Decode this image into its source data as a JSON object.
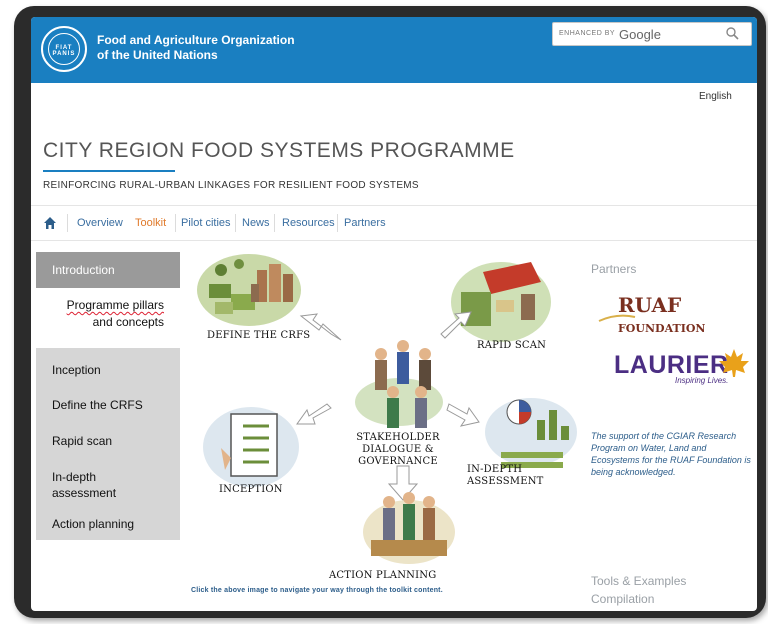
{
  "header": {
    "org_line1": "Food and Agriculture Organization",
    "org_line2": "of the United Nations",
    "logo_text": "FIAT PANIS",
    "search_enhanced": "ENHANCED BY",
    "search_brand": "Google"
  },
  "language": "English",
  "page": {
    "title": "CITY REGION FOOD SYSTEMS PROGRAMME",
    "subtitle": "REINFORCING RURAL-URBAN LINKAGES FOR RESILIENT FOOD SYSTEMS"
  },
  "nav": {
    "items": [
      "Overview",
      "Toolkit",
      "Pilot cities",
      "News",
      "Resources",
      "Partners"
    ],
    "active": "Toolkit"
  },
  "sidebar": {
    "intro": "Introduction",
    "sub_line1": "Programme pillars",
    "sub_line2": "and concepts",
    "items": [
      "Inception",
      "Define the CRFS",
      "Rapid scan",
      "In-depth",
      "assessment",
      "Action planning"
    ]
  },
  "illustration": {
    "define": "DEFINE THE CRFS",
    "rapid": "RAPID SCAN",
    "stake1": "STAKEHOLDER",
    "stake2": "DIALOGUE &",
    "stake3": "GOVERNANCE",
    "inception": "INCEPTION",
    "indepth1": "IN-DEPTH",
    "indepth2": "ASSESSMENT",
    "action": "ACTION PLANNING",
    "caption": "Click the above image to navigate your way through the toolkit content."
  },
  "right": {
    "partners_heading": "Partners",
    "ruaf_big": "RUAF",
    "ruaf_small": "FOUNDATION",
    "laurier": "LAURIER",
    "laurier_tagline": "Inspiring Lives.",
    "support_text": "The support of the CGIAR Research Program on Water, Land and Ecosystems for the RUAF Foundation is being acknowledged.",
    "tools_line1": "Tools & Examples",
    "tools_line2": "Compilation"
  },
  "colors": {
    "brand_blue": "#1a7fc1",
    "active_nav": "#e07a2b",
    "sidebar_grey": "#d6d6d6",
    "sidebar_active": "#9a9a9a"
  }
}
